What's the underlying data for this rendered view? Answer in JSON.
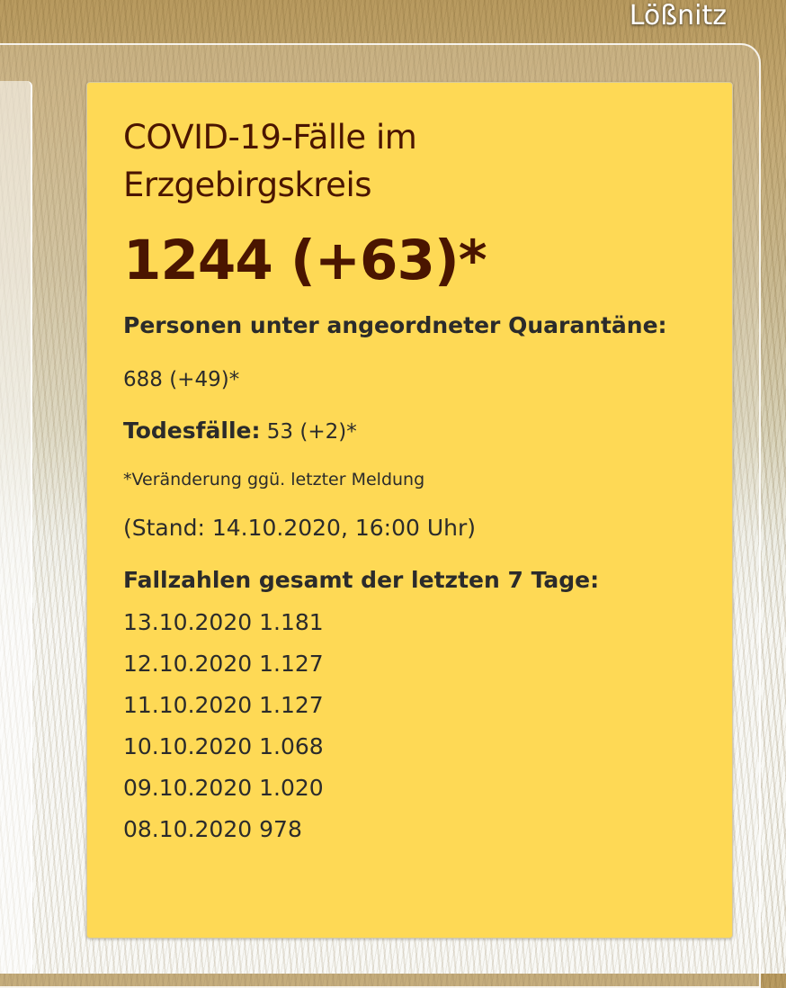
{
  "header": {
    "site_title": "Lößnitz"
  },
  "covid": {
    "title_line1": "COVID-19-Fälle im",
    "title_line2": "Erzgebirgskreis",
    "total_cases": "1244 (+63)*",
    "quarantine_label": "Personen unter angeordneter Quarantäne:",
    "quarantine_value": "688 (+49)*",
    "deaths_label": "Todesfälle:",
    "deaths_value": "53 (+2)*",
    "footnote": "*Veränderung ggü. letzter Meldung",
    "stand": "(Stand: 14.10.2020, 16:00 Uhr)",
    "seven_day_heading": "Fallzahlen gesamt der letzten 7 Tage:",
    "seven_day": [
      {
        "date": "13.10.2020",
        "value": "1.181"
      },
      {
        "date": "12.10.2020",
        "value": "1.127"
      },
      {
        "date": "11.10.2020",
        "value": "1.127"
      },
      {
        "date": "10.10.2020",
        "value": "1.068"
      },
      {
        "date": "09.10.2020",
        "value": "1.020"
      },
      {
        "date": "08.10.2020",
        "value": "978"
      }
    ]
  },
  "colors": {
    "box_background": "#fed955",
    "title_color": "#4a1500",
    "text_color": "#2b2b2b"
  }
}
